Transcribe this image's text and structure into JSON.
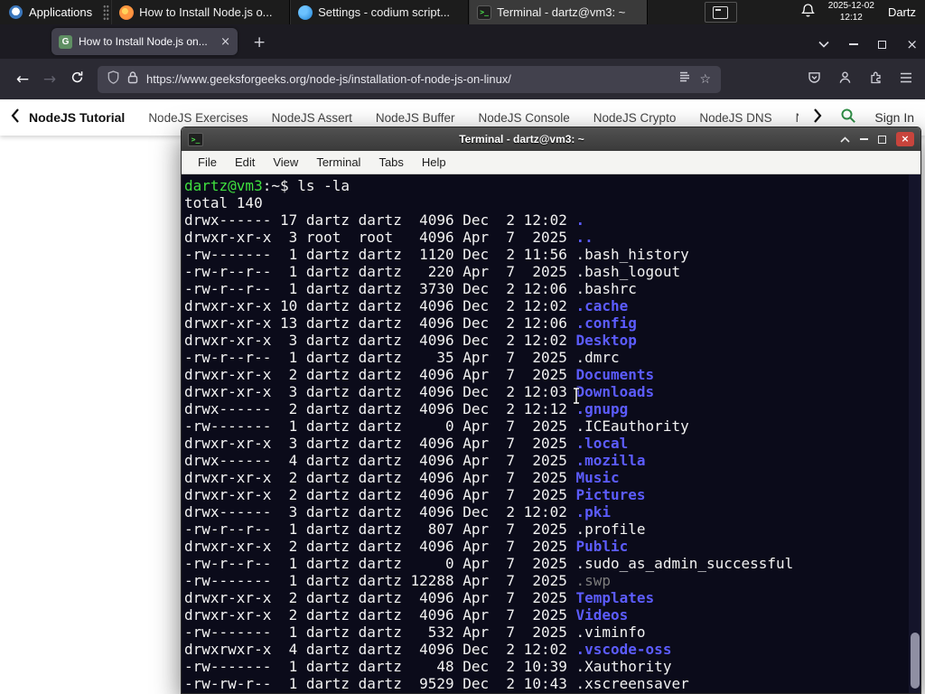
{
  "panel": {
    "applications_label": "Applications",
    "windows": [
      {
        "title": "How to Install Node.js o...",
        "icon": "firefox",
        "active": false
      },
      {
        "title": "Settings - codium script...",
        "icon": "codium",
        "active": false
      },
      {
        "title": "Terminal - dartz@vm3: ~",
        "icon": "terminal",
        "active": true
      }
    ],
    "clock_date": "2025-12-02",
    "clock_time": "12:12",
    "user": "Dartz"
  },
  "icons": {
    "terminal_glyph": ">_",
    "favicon_letter": "G",
    "back": "←",
    "forward": "→",
    "new_tab": "+",
    "tab_close": "×",
    "window_close": "×",
    "star": "☆"
  },
  "browser": {
    "tab_title": "How to Install Node.js on...",
    "url": "https://www.geeksforgeeks.org/node-js/installation-of-node-js-on-linux/",
    "nav_links": [
      "NodeJS Tutorial",
      "NodeJS Exercises",
      "NodeJS Assert",
      "NodeJS Buffer",
      "NodeJS Console",
      "NodeJS Crypto",
      "NodeJS DNS",
      "Node"
    ],
    "sign_in_label": "Sign In"
  },
  "terminal": {
    "title": "Terminal - dartz@vm3: ~",
    "menu": [
      "File",
      "Edit",
      "View",
      "Terminal",
      "Tabs",
      "Help"
    ],
    "prompt_user_host": "dartz@vm3",
    "prompt_rest": ":~$",
    "command": "ls -la",
    "total_line": "total 140",
    "colors": {
      "background": "#0b0b1a",
      "text": "#f2f2f2",
      "directory": "#5c5cff",
      "prompt": "#3fe03f",
      "dim": "#7d7d7d"
    },
    "entries": [
      {
        "meta": "drwx------ 17 dartz dartz  4096 Dec  2 12:02 ",
        "name": ".",
        "color": "dir"
      },
      {
        "meta": "drwxr-xr-x  3 root  root   4096 Apr  7  2025 ",
        "name": "..",
        "color": "dir"
      },
      {
        "meta": "-rw-------  1 dartz dartz  1120 Dec  2 11:56 ",
        "name": ".bash_history",
        "color": "file"
      },
      {
        "meta": "-rw-r--r--  1 dartz dartz   220 Apr  7  2025 ",
        "name": ".bash_logout",
        "color": "file"
      },
      {
        "meta": "-rw-r--r--  1 dartz dartz  3730 Dec  2 12:06 ",
        "name": ".bashrc",
        "color": "file"
      },
      {
        "meta": "drwxr-xr-x 10 dartz dartz  4096 Dec  2 12:02 ",
        "name": ".cache",
        "color": "dir"
      },
      {
        "meta": "drwxr-xr-x 13 dartz dartz  4096 Dec  2 12:06 ",
        "name": ".config",
        "color": "dir"
      },
      {
        "meta": "drwxr-xr-x  3 dartz dartz  4096 Dec  2 12:02 ",
        "name": "Desktop",
        "color": "dir"
      },
      {
        "meta": "-rw-r--r--  1 dartz dartz    35 Apr  7  2025 ",
        "name": ".dmrc",
        "color": "file"
      },
      {
        "meta": "drwxr-xr-x  2 dartz dartz  4096 Apr  7  2025 ",
        "name": "Documents",
        "color": "dir"
      },
      {
        "meta": "drwxr-xr-x  3 dartz dartz  4096 Dec  2 12:03 ",
        "name": "Downloads",
        "color": "dir"
      },
      {
        "meta": "drwx------  2 dartz dartz  4096 Dec  2 12:12 ",
        "name": ".gnupg",
        "color": "dir"
      },
      {
        "meta": "-rw-------  1 dartz dartz     0 Apr  7  2025 ",
        "name": ".ICEauthority",
        "color": "file"
      },
      {
        "meta": "drwxr-xr-x  3 dartz dartz  4096 Apr  7  2025 ",
        "name": ".local",
        "color": "dir"
      },
      {
        "meta": "drwx------  4 dartz dartz  4096 Apr  7  2025 ",
        "name": ".mozilla",
        "color": "dir"
      },
      {
        "meta": "drwxr-xr-x  2 dartz dartz  4096 Apr  7  2025 ",
        "name": "Music",
        "color": "dir"
      },
      {
        "meta": "drwxr-xr-x  2 dartz dartz  4096 Apr  7  2025 ",
        "name": "Pictures",
        "color": "dir"
      },
      {
        "meta": "drwx------  3 dartz dartz  4096 Dec  2 12:02 ",
        "name": ".pki",
        "color": "dir"
      },
      {
        "meta": "-rw-r--r--  1 dartz dartz   807 Apr  7  2025 ",
        "name": ".profile",
        "color": "file"
      },
      {
        "meta": "drwxr-xr-x  2 dartz dartz  4096 Apr  7  2025 ",
        "name": "Public",
        "color": "dir"
      },
      {
        "meta": "-rw-r--r--  1 dartz dartz     0 Apr  7  2025 ",
        "name": ".sudo_as_admin_successful",
        "color": "file"
      },
      {
        "meta": "-rw-------  1 dartz dartz 12288 Apr  7  2025 ",
        "name": ".swp",
        "color": "dim"
      },
      {
        "meta": "drwxr-xr-x  2 dartz dartz  4096 Apr  7  2025 ",
        "name": "Templates",
        "color": "dir"
      },
      {
        "meta": "drwxr-xr-x  2 dartz dartz  4096 Apr  7  2025 ",
        "name": "Videos",
        "color": "dir"
      },
      {
        "meta": "-rw-------  1 dartz dartz   532 Apr  7  2025 ",
        "name": ".viminfo",
        "color": "file"
      },
      {
        "meta": "drwxrwxr-x  4 dartz dartz  4096 Dec  2 12:02 ",
        "name": ".vscode-oss",
        "color": "dir"
      },
      {
        "meta": "-rw-------  1 dartz dartz    48 Dec  2 10:39 ",
        "name": ".Xauthority",
        "color": "file"
      },
      {
        "meta": "-rw-rw-r--  1 dartz dartz  9529 Dec  2 10:43 ",
        "name": ".xscreensaver",
        "color": "file"
      }
    ]
  }
}
